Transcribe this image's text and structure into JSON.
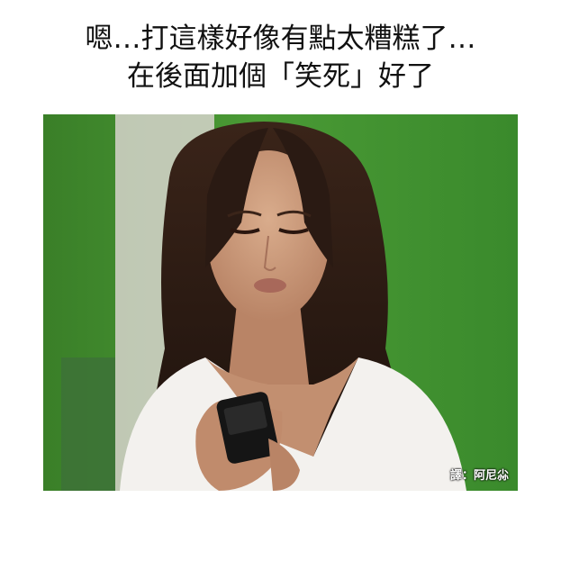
{
  "caption": {
    "line1": "嗯…打這樣好像有點太糟糕了…",
    "line2": "在後面加個「笑死」好了"
  },
  "photo": {
    "credit": "譯：阿尼尛",
    "colors": {
      "green_screen": "#3f8f2e",
      "hair": "#2a1a14",
      "skin": "#c99a7a",
      "top": "#f2f0ee",
      "phone": "#151515"
    }
  }
}
